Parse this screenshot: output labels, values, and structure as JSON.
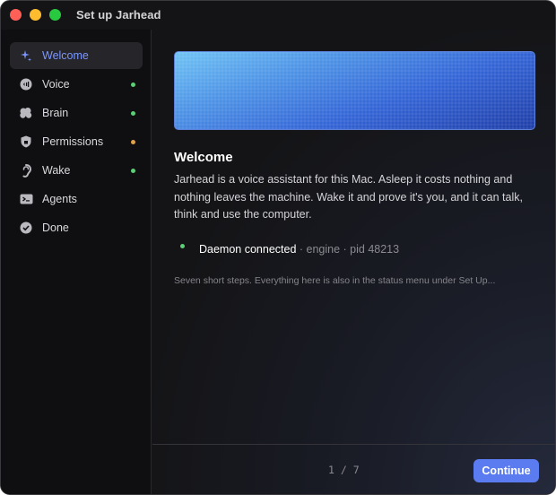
{
  "window": {
    "title": "Set up Jarhead"
  },
  "colors": {
    "accent": "#7c96ff",
    "button": "#5b7cf0",
    "status_ok": "#5ccf77",
    "status_warn": "#e0a24a"
  },
  "sidebar": {
    "items": [
      {
        "label": "Welcome",
        "icon": "sparkle-icon",
        "active": true,
        "status": ""
      },
      {
        "label": "Voice",
        "icon": "voice-icon",
        "active": false,
        "status": "ok"
      },
      {
        "label": "Brain",
        "icon": "brain-icon",
        "active": false,
        "status": "ok"
      },
      {
        "label": "Permissions",
        "icon": "shield-icon",
        "active": false,
        "status": "warn"
      },
      {
        "label": "Wake",
        "icon": "ear-icon",
        "active": false,
        "status": "ok"
      },
      {
        "label": "Agents",
        "icon": "terminal-icon",
        "active": false,
        "status": ""
      },
      {
        "label": "Done",
        "icon": "checkmark-icon",
        "active": false,
        "status": ""
      }
    ]
  },
  "main": {
    "heading": "Welcome",
    "description": "Jarhead is a voice assistant for this Mac. Asleep it costs nothing and nothing leaves the machine. Wake it and prove it's you, and it can talk, think and use the computer.",
    "status": {
      "label": "Daemon connected",
      "meta": " · engine · pid 48213"
    },
    "hint": "Seven short steps. Everything here is also in the status menu under Set Up..."
  },
  "footer": {
    "page": "1 / 7",
    "continue_label": "Continue"
  }
}
